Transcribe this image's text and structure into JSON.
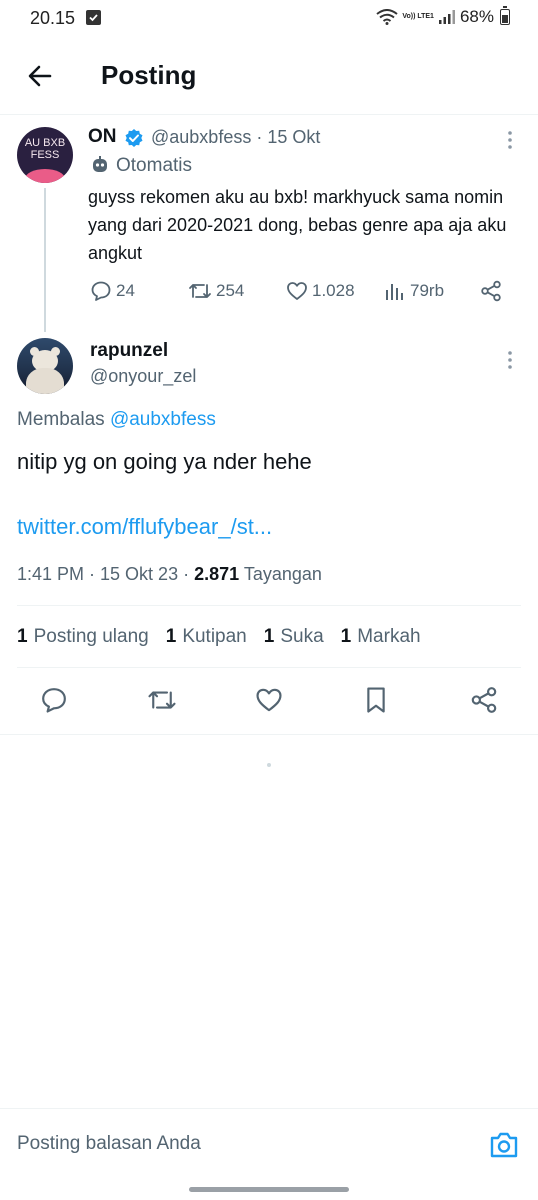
{
  "status_bar": {
    "time": "20.15",
    "lte_label": "Vo)) LTE1",
    "battery": "68%"
  },
  "header": {
    "title": "Posting"
  },
  "parent_tweet": {
    "avatar_text": "AU BXB FESS",
    "name": "ON",
    "verified": true,
    "handle_date": "@aubxbfess · 15 Okt",
    "automated_label": "Otomatis",
    "text": "guyss rekomen aku au bxb! markhyuck sama nomin yang dari 2020-2021 dong, bebas genre apa aja aku angkut",
    "replies": "24",
    "reposts": "254",
    "likes": "1.028",
    "views": "79rb"
  },
  "reply_tweet": {
    "name": "rapunzel",
    "handle": "@onyour_zel",
    "replying_to_prefix": "Membalas",
    "replying_to_handle": "@aubxbfess",
    "text": "nitip yg on going ya nder hehe",
    "link": "twitter.com/fflufybear_/st...",
    "timestamp": "1:41 PM · 15 Okt 23 ·",
    "views_count": "2.871",
    "views_label": "Tayangan",
    "stats": [
      {
        "count": "1",
        "label": "Posting ulang"
      },
      {
        "count": "1",
        "label": "Kutipan"
      },
      {
        "count": "1",
        "label": "Suka"
      },
      {
        "count": "1",
        "label": "Markah"
      }
    ]
  },
  "compose": {
    "placeholder": "Posting balasan Anda"
  },
  "colors": {
    "accent": "#1d9bf0",
    "secondary_text": "#536471",
    "primary_text": "#0f1419"
  }
}
